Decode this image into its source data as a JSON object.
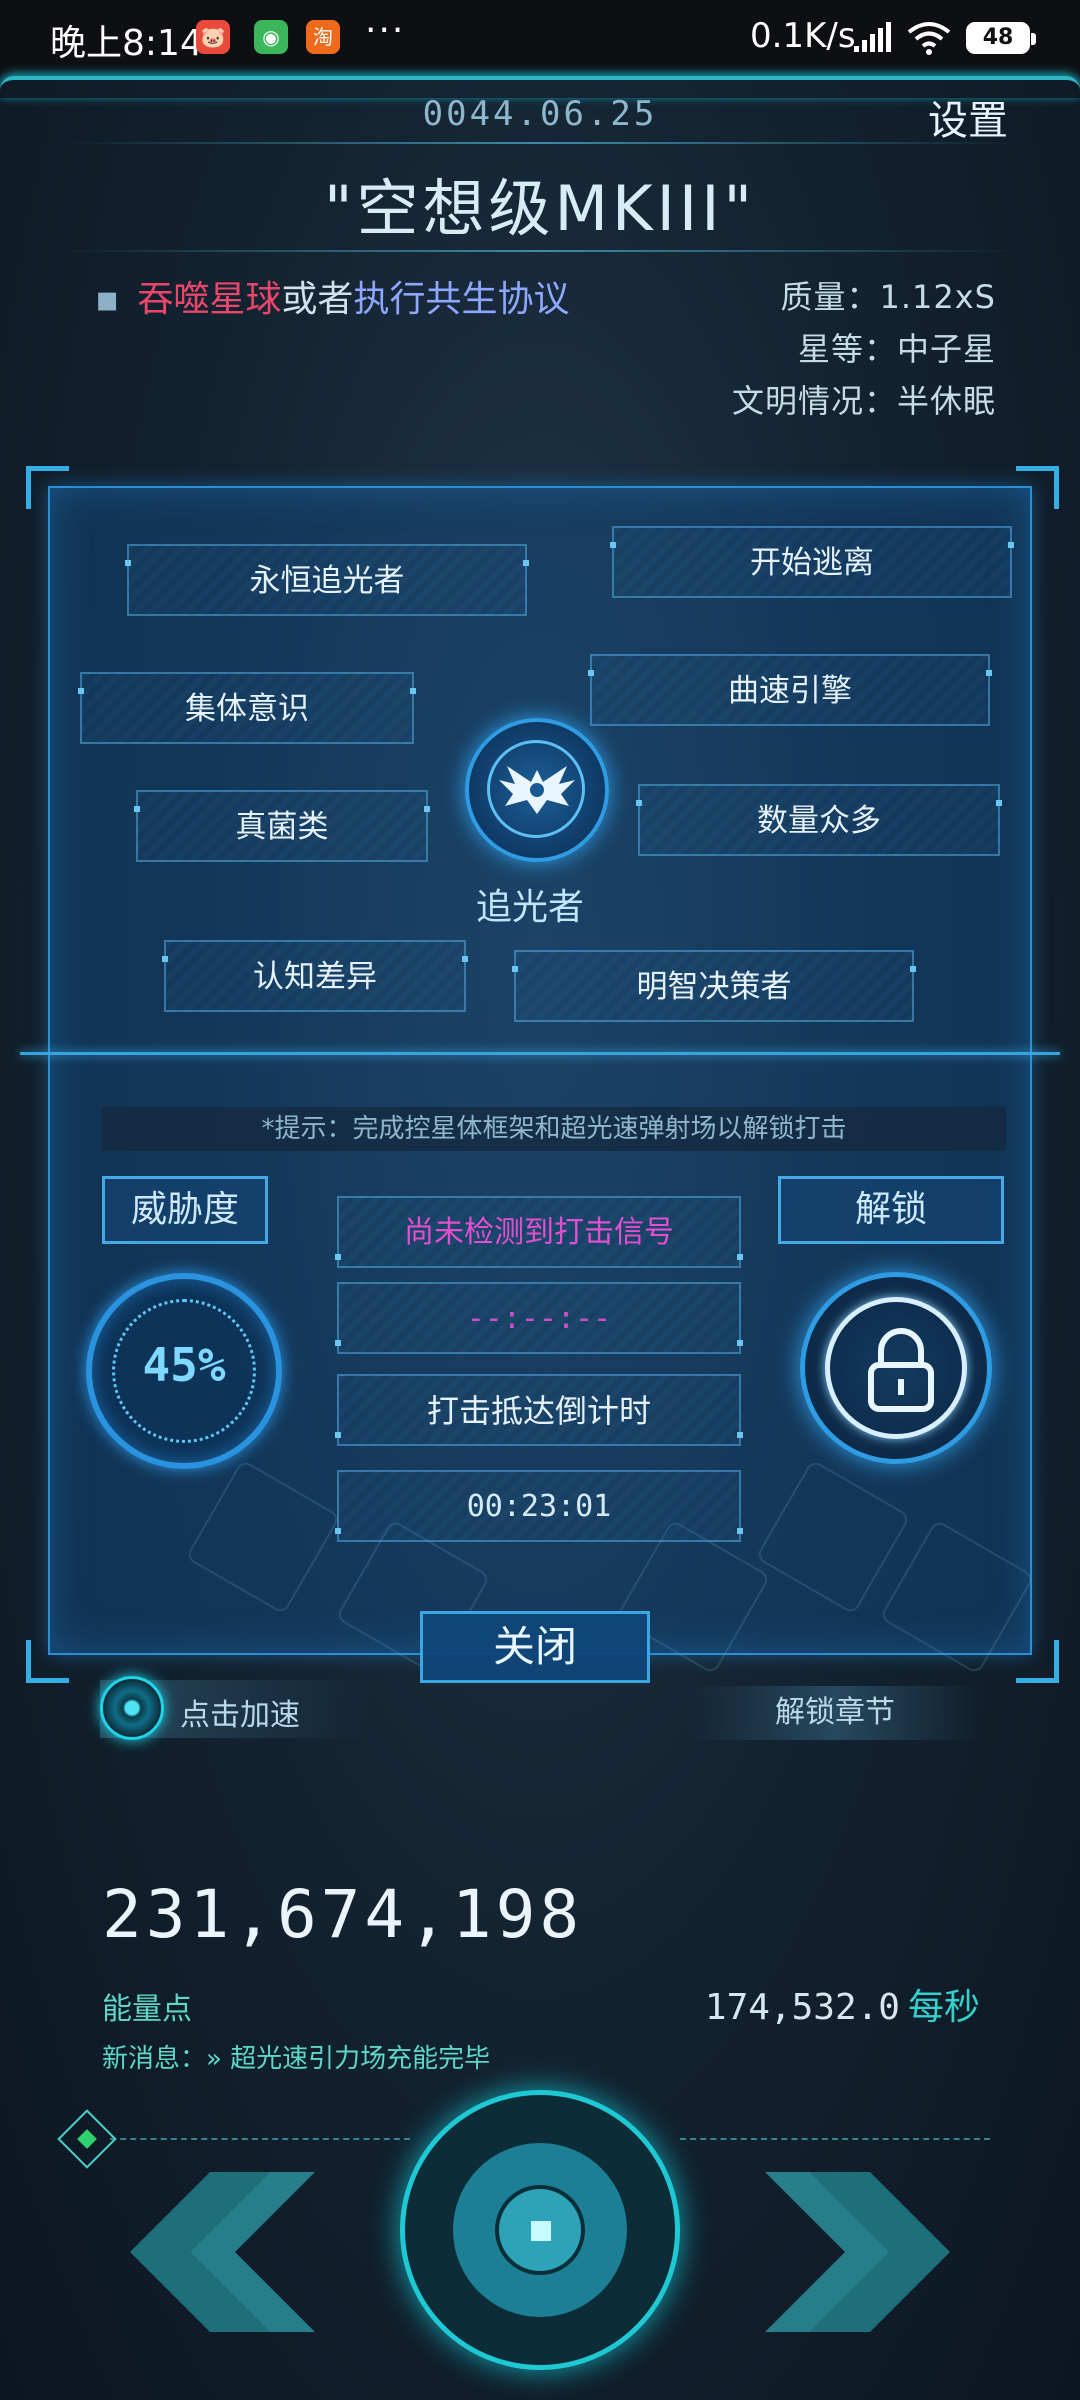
{
  "status_bar": {
    "time": "晚上8:14",
    "apps": [
      "🐷",
      "◉",
      "淘"
    ],
    "more": "···",
    "net_speed": "0.1K/s",
    "battery": "48"
  },
  "header": {
    "date": "0044.06.25",
    "settings_label": "设置",
    "title": "\"空想级MKIII\""
  },
  "goal": {
    "bullet": "▪",
    "part1": "吞噬星球",
    "part2": "或者",
    "part3": "执行共生协议"
  },
  "planet_info": {
    "mass": "质量：1.12xS",
    "star_class": "星等：中子星",
    "civilization": "文明情况：半休眠"
  },
  "traits": [
    "永恒追光者",
    "开始逃离",
    "集体意识",
    "曲速引擎",
    "真菌类",
    "数量众多",
    "认知差异",
    "明智决策者"
  ],
  "civ_name": "追光者",
  "strike": {
    "hint": "*提示：完成控星体框架和超光速弹射场以解锁打击",
    "threat_label": "威胁度",
    "threat_value": "45%",
    "threat_level": 0.45,
    "unlock_label": "解锁",
    "signal_status": "尚未检测到打击信号",
    "signal_time": "--:--:--",
    "countdown_label": "打击抵达倒计时",
    "countdown_value": "00:23:01"
  },
  "close_label": "关闭",
  "boost_label": "点击加速",
  "unlock_chapter_label": "解锁章节",
  "energy": {
    "value": "231,674,198",
    "label": "能量点",
    "rate": "174,532.0",
    "rate_unit": "每秒"
  },
  "news": "新消息：» 超光速引力场充能完毕",
  "colors": {
    "accent_blue": "#2f9be2",
    "accent_teal": "#1fc9d4",
    "red_text": "#e8476a",
    "magenta_text": "#e24fd0"
  }
}
